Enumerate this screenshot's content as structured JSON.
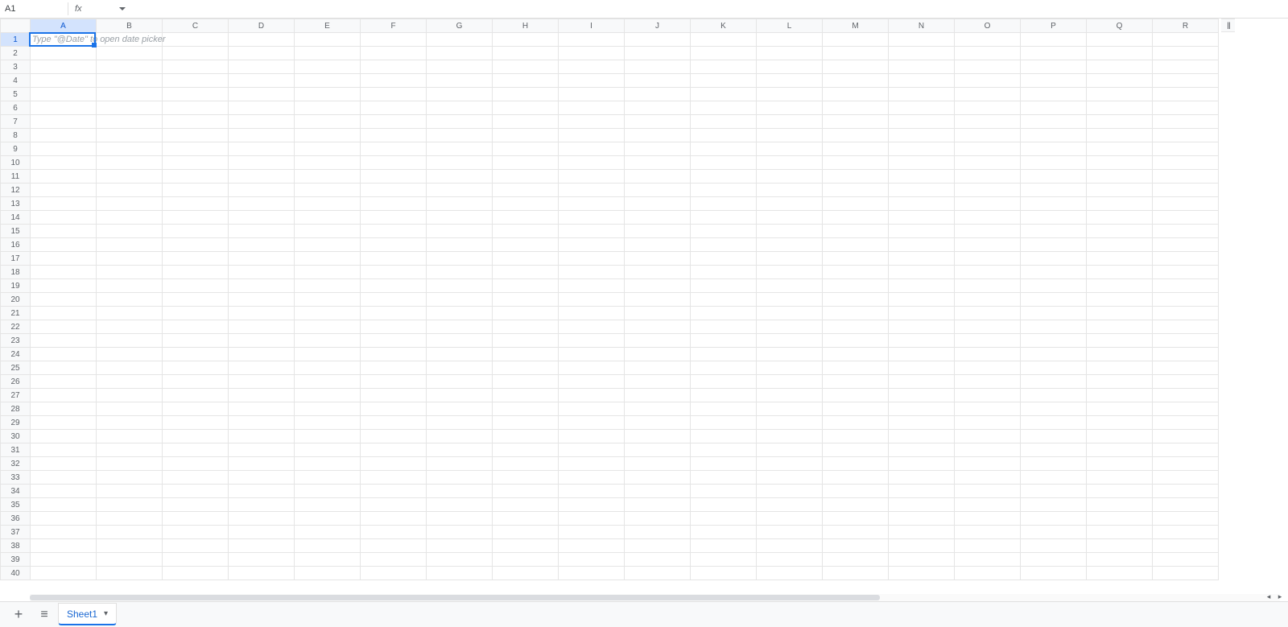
{
  "name_box": {
    "value": "A1"
  },
  "fx": {
    "label": "fx"
  },
  "columns": [
    "A",
    "B",
    "C",
    "D",
    "E",
    "F",
    "G",
    "H",
    "I",
    "J",
    "K",
    "L",
    "M",
    "N",
    "O",
    "P",
    "Q",
    "R"
  ],
  "row_count": 40,
  "active_cell": {
    "col": "A",
    "row": 1,
    "hint": "Type \"@Date\" to open date picker"
  },
  "active_col_index": 0,
  "active_row_index": 0,
  "tab": {
    "active_label": "Sheet1"
  },
  "icons": {
    "add": "+",
    "all_sheets": "≡",
    "caret_down": "▾",
    "hide_bars": "‖"
  }
}
